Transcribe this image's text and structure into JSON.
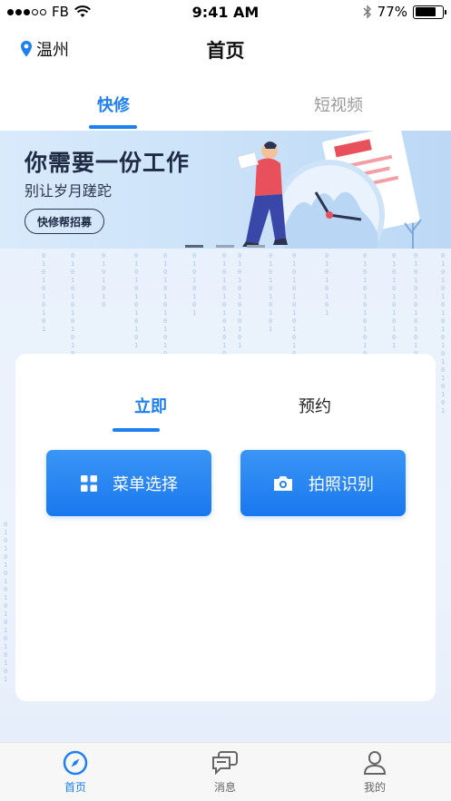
{
  "status_bar": {
    "carrier": "FB",
    "time": "9:41 AM",
    "battery": "77%",
    "battery_level": 0.77
  },
  "header": {
    "location": "温州",
    "title": "首页"
  },
  "top_tabs": [
    {
      "label": "快修",
      "active": true
    },
    {
      "label": "短视频",
      "active": false
    }
  ],
  "banner": {
    "title": "你需要一份工作",
    "subtitle": "别让岁月蹉跎",
    "button_label": "快修帮招募"
  },
  "card": {
    "tabs": [
      {
        "label": "立即",
        "active": true
      },
      {
        "label": "预约",
        "active": false
      }
    ],
    "buttons": [
      {
        "label": "菜单选择",
        "icon": "grid-icon"
      },
      {
        "label": "拍照识别",
        "icon": "camera-icon"
      }
    ]
  },
  "bottom_nav": [
    {
      "label": "首页",
      "icon": "compass-icon",
      "active": true
    },
    {
      "label": "消息",
      "icon": "chat-icon",
      "active": false
    },
    {
      "label": "我的",
      "icon": "user-icon",
      "active": false
    }
  ],
  "colors": {
    "accent": "#1d7ff0",
    "inactive_tab": "#9a9a9a",
    "banner_bg": "#d9eafb"
  }
}
